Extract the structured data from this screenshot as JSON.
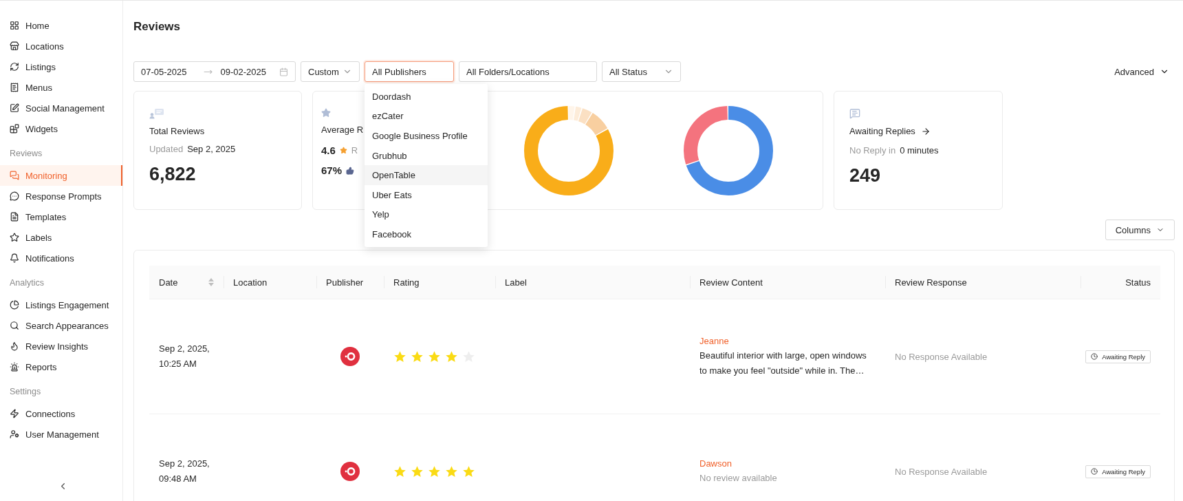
{
  "sidebar": {
    "groups": [
      {
        "items": [
          {
            "label": "Home",
            "selected": false
          },
          {
            "label": "Locations",
            "selected": false
          },
          {
            "label": "Listings",
            "selected": false
          },
          {
            "label": "Menus",
            "selected": false
          },
          {
            "label": "Social Management",
            "selected": false
          },
          {
            "label": "Widgets",
            "selected": false
          }
        ]
      },
      {
        "heading": "Reviews",
        "items": [
          {
            "label": "Monitoring",
            "selected": true
          },
          {
            "label": "Response Prompts",
            "selected": false
          },
          {
            "label": "Templates",
            "selected": false
          },
          {
            "label": "Labels",
            "selected": false
          },
          {
            "label": "Notifications",
            "selected": false
          }
        ]
      },
      {
        "heading": "Analytics",
        "items": [
          {
            "label": "Listings Engagement",
            "selected": false
          },
          {
            "label": "Search Appearances",
            "selected": false
          },
          {
            "label": "Review Insights",
            "selected": false
          },
          {
            "label": "Reports",
            "selected": false
          }
        ]
      },
      {
        "heading": "Settings",
        "items": [
          {
            "label": "Connections",
            "selected": false
          },
          {
            "label": "User Management",
            "selected": false
          }
        ]
      }
    ]
  },
  "page": {
    "title": "Reviews"
  },
  "filters": {
    "date_from": "07-05-2025",
    "date_to": "09-02-2025",
    "range": "Custom",
    "publisher": "All Publishers",
    "publisher_open": true,
    "folders": "All Folders/Locations",
    "status": "All Status",
    "advanced": "Advanced"
  },
  "publisher_menu": [
    {
      "label": "Doordash",
      "highlighted": false
    },
    {
      "label": "ezCater",
      "highlighted": false
    },
    {
      "label": "Google Business Profile",
      "highlighted": false
    },
    {
      "label": "Grubhub",
      "highlighted": false
    },
    {
      "label": "OpenTable",
      "highlighted": true
    },
    {
      "label": "Uber Eats",
      "highlighted": false
    },
    {
      "label": "Yelp",
      "highlighted": false
    },
    {
      "label": "Facebook",
      "highlighted": false
    }
  ],
  "total_card": {
    "title": "Total Reviews",
    "updated_label": "Updated",
    "updated_date": "Sep 2, 2025",
    "value": "6,822"
  },
  "rating_card": {
    "title": "Average R",
    "rating": "4.6",
    "rating_suffix": "R",
    "positive": "67%"
  },
  "awaiting_card": {
    "title": "Awaiting Replies",
    "note_label": "No Reply in",
    "note_value": "0 minutes",
    "value": "249"
  },
  "columns_button": "Columns",
  "table": {
    "columns": [
      {
        "label": "Date",
        "sortable": true
      },
      {
        "label": "Location",
        "sortable": false
      },
      {
        "label": "Publisher",
        "sortable": false
      },
      {
        "label": "Rating",
        "sortable": false
      },
      {
        "label": "Label",
        "sortable": false
      },
      {
        "label": "Review Content",
        "sortable": false
      },
      {
        "label": "Review Response",
        "sortable": false
      },
      {
        "label": "Status",
        "sortable": false
      }
    ],
    "rows": [
      {
        "date": "Sep 2, 2025, 10:25 AM",
        "stars": 4,
        "reviewer": "Jeanne",
        "content": "Beautiful interior with large, open windows to make you feel \"outside\" while in. The…",
        "content_empty": false,
        "response": "No Response Available",
        "status": "Awaiting Reply"
      },
      {
        "date": "Sep 2, 2025, 09:48 AM",
        "stars": 5,
        "reviewer": "Dawson",
        "content": "No review available",
        "content_empty": true,
        "response": "No Response Available",
        "status": "Awaiting Reply"
      }
    ]
  }
}
